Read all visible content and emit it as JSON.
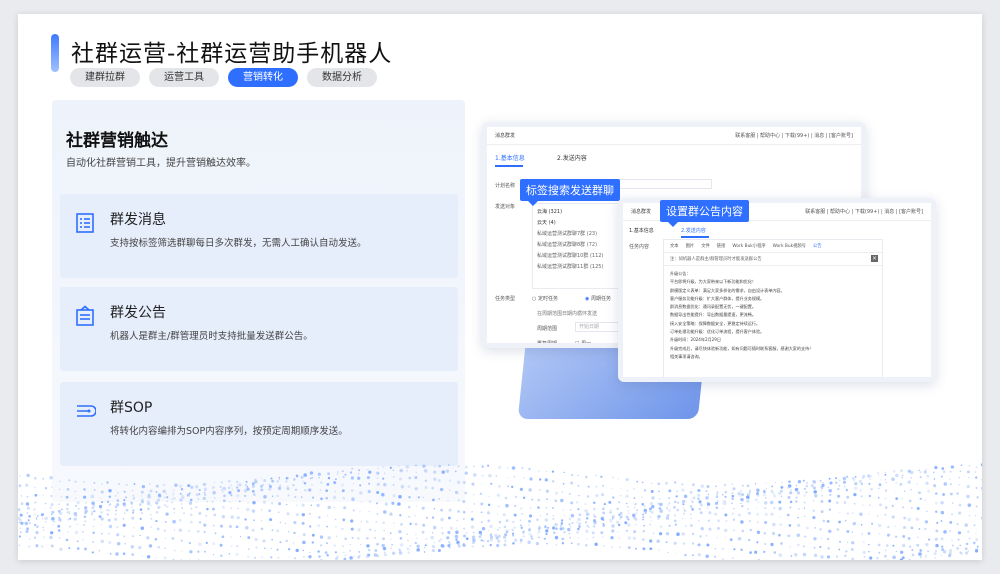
{
  "header": {
    "title": "社群运营-社群运营助手机器人",
    "tabs": [
      {
        "label": "建群拉群",
        "active": false
      },
      {
        "label": "运营工具",
        "active": false
      },
      {
        "label": "营销转化",
        "active": true
      },
      {
        "label": "数据分析",
        "active": false
      }
    ]
  },
  "section": {
    "title": "社群营销触达",
    "subtitle": "自动化社群营销工具，提升营销触达效率。"
  },
  "features": [
    {
      "icon": "document-list-icon",
      "title": "群发消息",
      "desc": "支持按标签筛选群聊每日多次群发，无需人工确认自动发送。"
    },
    {
      "icon": "announcement-icon",
      "title": "群发公告",
      "desc": "机器人是群主/群管理员时支持批量发送群公告。"
    },
    {
      "icon": "sop-flow-icon",
      "title": "群SOP",
      "desc": "将转化内容编排为SOP内容序列，按预定周期顺序发送。"
    }
  ],
  "screenshot1": {
    "window_title": "消息群发",
    "toolbar": "联系客服 | 帮助中心 | 下载(99+) | 消息 | [客户账号]",
    "step1": "1.基本信息",
    "step2": "2.发送内容",
    "field_plan": "计划名称",
    "field_target": "发送对象",
    "options": [
      "云海 (321)",
      "云天 (4)",
      "私域运营测试群聊7群 (23)",
      "私域运营测试群聊8群 (72)",
      "私域运营测试群聊10群 (112)",
      "私域运营测试群聊11群 (125)"
    ],
    "field_type": "任务类型",
    "type_timed": "定时任务",
    "type_cycle": "周期任务",
    "cycle_hint": "在周期范围日期内循环发送",
    "cycle_range": "周期范围",
    "date_placeholder": "开始日期",
    "repeat_label": "重复周期",
    "week_mon": "周一",
    "bubble": "标签搜索发送群聊"
  },
  "screenshot2": {
    "window_title": "消息群发",
    "toolbar": "联系客服 | 帮助中心 | 下载(99+) | 消息 | [客户账号]",
    "step1": "1.基本信息",
    "step2": "2.发送内容",
    "field_content": "任务内容",
    "content_tabs": [
      "文本",
      "图片",
      "文件",
      "链接",
      "Work Buk小程序",
      "Work Buk视频号",
      "公告"
    ],
    "note": "注：如机器人是群主/群管理员时才能发送群公告",
    "announcement_title": "升级公告：",
    "announcement_lines": [
      "平台即将升级，为大家带来以下新功能和优化！",
      "群模版定义表单：满足大家多样化的需求，自由设计表单内容。",
      "客户服务功能升级：扩大客户群体，提升业务规模。",
      "群消息数据优化：通讯录配置无忧，一键配置。",
      "数据导出性能提升：导出数据量提速，更流畅。",
      "接入安全策略：保障数据安全，更稳定持续运行。",
      "订单处理功能升级：优化订单流程，提升客户体验。"
    ],
    "upgrade_time": "升级时间：2024年2月29日",
    "closing": "升级完成后，请尽快体验新功能，如有问题可随时联系客服，感谢大家的支持！",
    "sign": "相关事项请咨询。",
    "bubble": "设置群公告内容"
  },
  "colors": {
    "accent": "#2f6fff",
    "panel": "#e6eefb"
  }
}
